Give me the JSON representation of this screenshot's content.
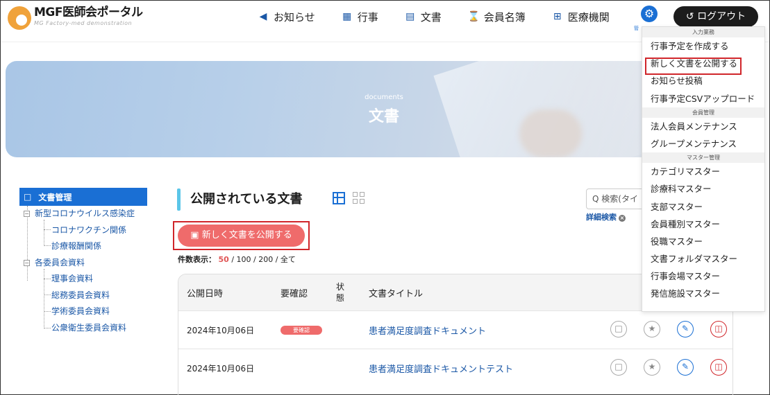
{
  "header": {
    "logo_title": "MGF医師会ポータル",
    "logo_sub": "MG Factory-med demonstration",
    "nav": [
      {
        "label": "お知らせ",
        "icon": "megaphone-icon",
        "glyph": "📢"
      },
      {
        "label": "行事",
        "icon": "calendar-icon",
        "glyph": "📅"
      },
      {
        "label": "文書",
        "icon": "document-icon",
        "glyph": "🗎"
      },
      {
        "label": "会員名簿",
        "icon": "hourglass-icon",
        "glyph": "⌛"
      },
      {
        "label": "医療機関",
        "icon": "hospital-icon",
        "glyph": "⊞"
      }
    ],
    "gear_caption": "管",
    "logout_label": "ログアウト"
  },
  "hero": {
    "subtitle": "documents",
    "title": "文書"
  },
  "tree": {
    "root": "文書管理",
    "groups": [
      {
        "label": "新型コロナウイルス感染症",
        "children": [
          "コロナワクチン関係",
          "診療報酬関係"
        ]
      },
      {
        "label": "各委員会資料",
        "children": [
          "理事会資料",
          "総務委員会資料",
          "学術委員会資料",
          "公衆衛生委員会資料"
        ]
      }
    ]
  },
  "main": {
    "section_title": "公開されている文書",
    "search_placeholder": "Q 検索(タイ",
    "advanced_search": "詳細検索",
    "publish_button": "新しく文書を公開する",
    "count_prefix": "件数表示：",
    "count_options": [
      "50",
      "/ 100 / 200 / 全て"
    ]
  },
  "table": {
    "headers": [
      "公開日時",
      "要確認",
      "状態",
      "文書タイトル"
    ],
    "rows": [
      {
        "date": "2024年10月06日",
        "badge": "要確認",
        "title": "患者満足度調査ドキュメント"
      },
      {
        "date": "2024年10月06日",
        "badge": "",
        "title": "患者満足度調査ドキュメントテスト"
      }
    ]
  },
  "menu": {
    "sections": [
      {
        "heading": "入力業務",
        "items": [
          "行事予定を作成する",
          "新しく文書を公開する",
          "お知らせ投稿",
          "行事予定CSVアップロード"
        ]
      },
      {
        "heading": "会員管理",
        "items": [
          "法人会員メンテナンス",
          "グループメンテナンス"
        ]
      },
      {
        "heading": "マスター管理",
        "items": [
          "カテゴリマスター",
          "診療科マスター",
          "支部マスター",
          "会員種別マスター",
          "役職マスター",
          "文書フォルダマスター",
          "行事会場マスター",
          "発信施設マスター"
        ]
      }
    ]
  },
  "colors": {
    "accent": "#1a6fd4",
    "publish": "#ef6b6b",
    "highlight": "#d0252a",
    "section_bar": "#5bc6e8"
  }
}
